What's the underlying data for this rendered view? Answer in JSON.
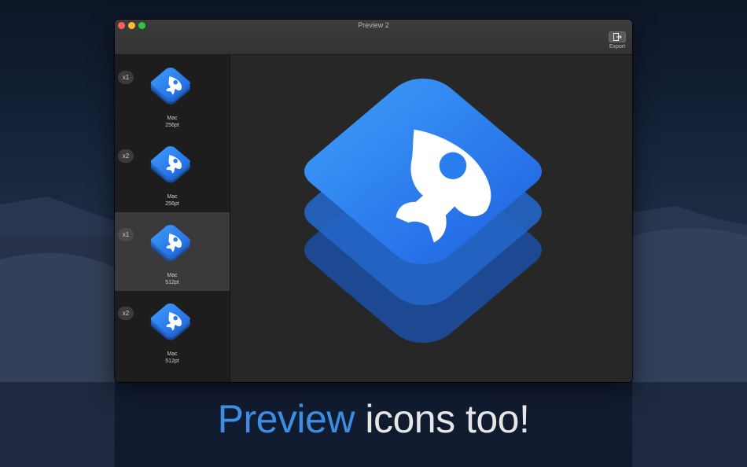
{
  "window": {
    "title": "Preview 2",
    "export_label": "Export"
  },
  "sidebar": {
    "items": [
      {
        "scale": "x1",
        "platform": "Mac",
        "size": "256pt",
        "selected": false
      },
      {
        "scale": "x2",
        "platform": "Mac",
        "size": "256pt",
        "selected": false
      },
      {
        "scale": "x1",
        "platform": "Mac",
        "size": "512pt",
        "selected": true
      },
      {
        "scale": "x2",
        "platform": "Mac",
        "size": "512pt",
        "selected": false
      }
    ]
  },
  "caption": {
    "highlight": "Preview",
    "rest": " icons too!"
  },
  "icons": {
    "app_icon": "rocket-layers-icon",
    "export": "export-icon"
  },
  "colors": {
    "accent": "#3d8ee3",
    "icon_blue_top": "#2f8cf5",
    "icon_blue_bottom": "#1f5fd6",
    "caption_text": "#e6e6e6"
  }
}
